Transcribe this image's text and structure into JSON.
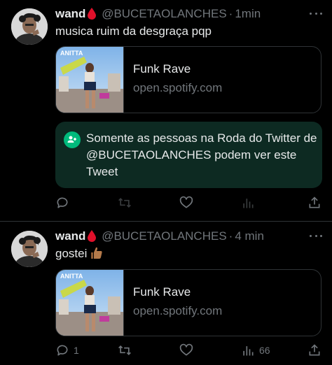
{
  "tweets": [
    {
      "author_name": "wand",
      "author_handle": "@BUCETAOLANCHES",
      "separator": "·",
      "time": "1min",
      "text": "musica ruim da desgraça pqp",
      "card": {
        "title": "Funk Rave",
        "domain": "open.spotify.com",
        "thumbnail_text": "ANITTA"
      },
      "circle_notice": "Somente as pessoas na Roda do Twitter de @BUCETAOLANCHES podem ver este Tweet",
      "actions": {
        "reply_count": "",
        "retweet_count": "",
        "like_count": "",
        "views_count": ""
      }
    },
    {
      "author_name": "wand",
      "author_handle": "@BUCETAOLANCHES",
      "separator": "·",
      "time": "4 min",
      "text": "gostei",
      "text_emoji": "thumbs-up",
      "card": {
        "title": "Funk Rave",
        "domain": "open.spotify.com",
        "thumbnail_text": "ANITTA"
      },
      "actions": {
        "reply_count": "1",
        "retweet_count": "",
        "like_count": "",
        "views_count": "66"
      }
    }
  ],
  "colors": {
    "background": "#000000",
    "text_primary": "#e7e9ea",
    "text_secondary": "#71767b",
    "border": "#2f3336",
    "circle_bg": "#0d2a22",
    "circle_icon": "#00ba7c",
    "drop_red": "#e0102a"
  },
  "icons": [
    "blood-drop-icon",
    "more-icon",
    "circle-people-icon",
    "reply-icon",
    "retweet-icon",
    "like-icon",
    "views-icon",
    "share-icon",
    "thumbs-up-emoji"
  ]
}
